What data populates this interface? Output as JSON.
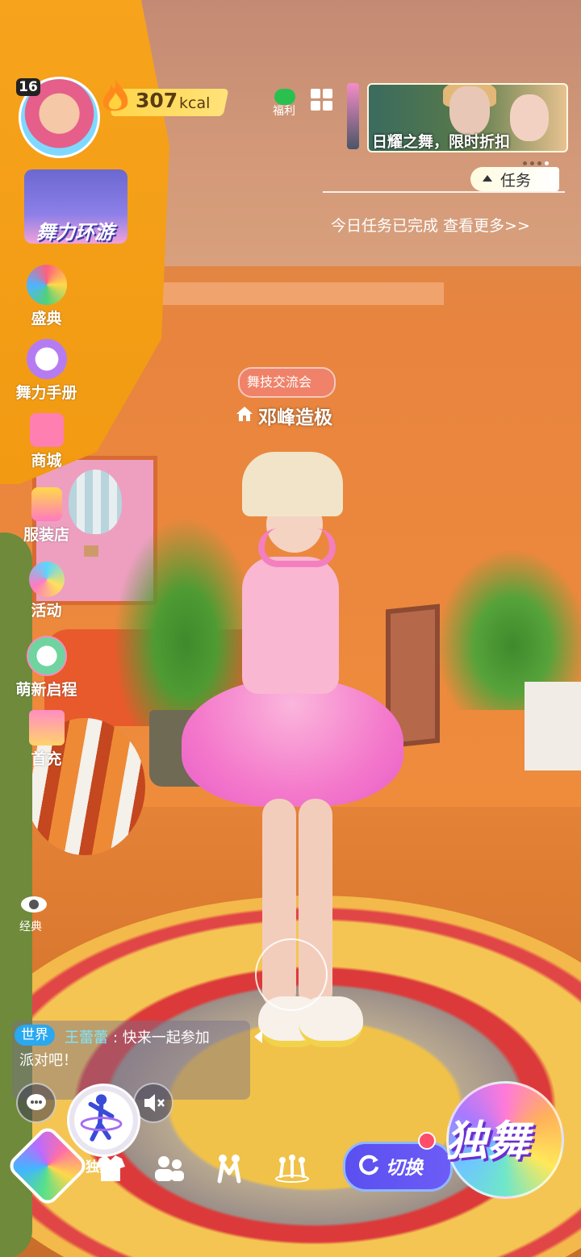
{
  "player": {
    "level": "16",
    "kcal_value": "307",
    "kcal_unit": "kcal"
  },
  "top_right": {
    "welfare_label": "福利",
    "banner_text": "日耀之舞，限时折扣",
    "banner_pages": 4,
    "banner_active_page": 4
  },
  "tasks": {
    "button_label": "任务",
    "status_text": "今日任务已完成 查看更多>>"
  },
  "sidebar": {
    "tour_label": "舞力环游",
    "items": [
      {
        "label": "盛典",
        "icon": "globe-icon"
      },
      {
        "label": "舞力手册",
        "icon": "rabbit-icon"
      },
      {
        "label": "商城",
        "icon": "cart-icon"
      },
      {
        "label": "服装店",
        "icon": "shopping-bag-icon"
      },
      {
        "label": "活动",
        "icon": "music-note-icon"
      },
      {
        "label": "萌新启程",
        "icon": "newbie-icon"
      },
      {
        "label": "首充",
        "icon": "gift-icon"
      }
    ],
    "view_label": "经典"
  },
  "location": {
    "tag": "舞技交流会",
    "name": "邓峰造极"
  },
  "chat": {
    "channel": "世界",
    "sender": "王蕾蕾",
    "message_line1": ":  快来一起参加",
    "message_line2": "派对吧！"
  },
  "bottom": {
    "dance_label": "独舞",
    "switch_label": "切换",
    "solo_label": "独舞"
  },
  "colors": {
    "accent": "#f7a31c",
    "kcal_bar": "#ffd64a",
    "world_tag": "#2aa8f0",
    "switch": "#5a4ff0"
  }
}
